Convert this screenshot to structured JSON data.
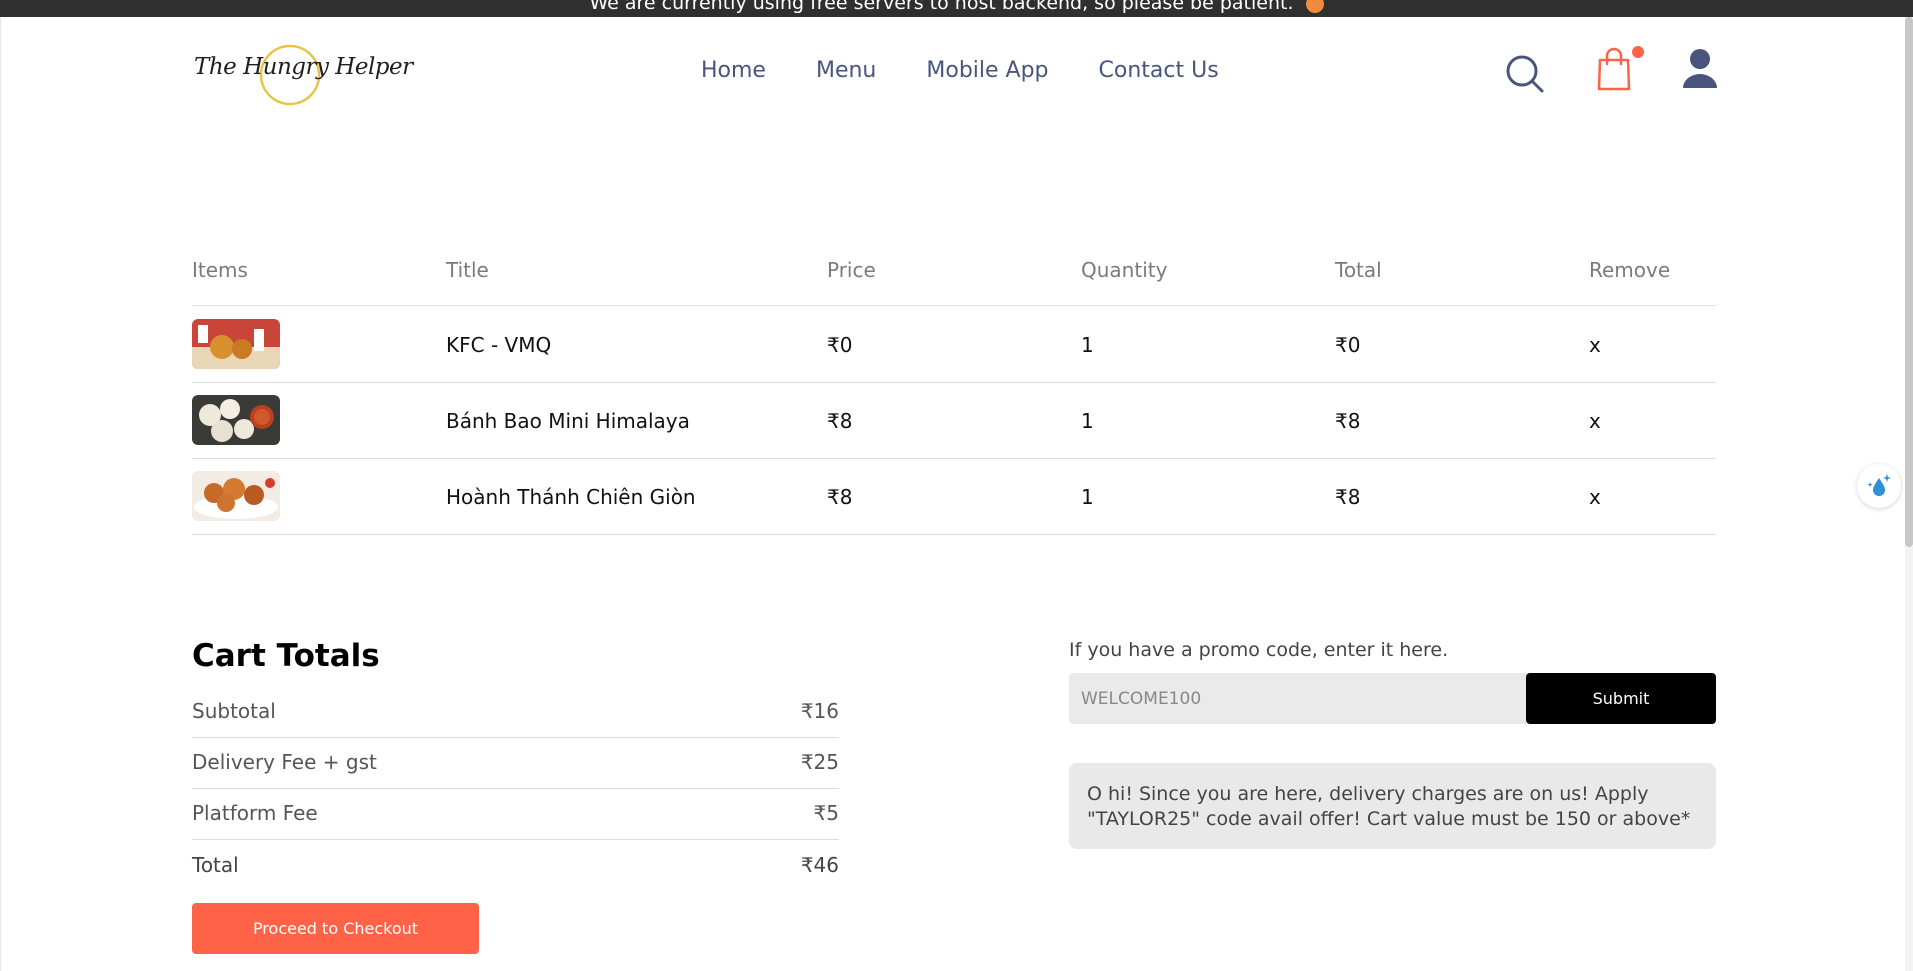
{
  "banner": {
    "text": "We are currently using free servers to host backend, so please be patient."
  },
  "brand": {
    "logo_text": "The Hungry Helper"
  },
  "nav": {
    "items": [
      "Home",
      "Menu",
      "Mobile App",
      "Contact Us"
    ]
  },
  "header_icons": {
    "search": "search-icon",
    "cart": "shopping-bag-icon",
    "profile": "user-icon",
    "cart_badge_color": "#ff6347"
  },
  "cart": {
    "headers": {
      "items": "Items",
      "title": "Title",
      "price": "Price",
      "quantity": "Quantity",
      "total": "Total",
      "remove": "Remove"
    },
    "rows": [
      {
        "title": "KFC - VMQ",
        "price": "₹0",
        "quantity": "1",
        "total": "₹0",
        "remove": "x"
      },
      {
        "title": "Bánh Bao Mini Himalaya",
        "price": "₹8",
        "quantity": "1",
        "total": "₹8",
        "remove": "x"
      },
      {
        "title": "Hoành Thánh Chiên Giòn",
        "price": "₹8",
        "quantity": "1",
        "total": "₹8",
        "remove": "x"
      }
    ]
  },
  "totals": {
    "heading": "Cart Totals",
    "subtotal_label": "Subtotal",
    "subtotal_value": "₹16",
    "delivery_label": "Delivery Fee + gst",
    "delivery_value": "₹25",
    "platform_label": "Platform Fee",
    "platform_value": "₹5",
    "total_label": "Total",
    "total_value": "₹46",
    "checkout_label": "Proceed to Checkout"
  },
  "promo": {
    "label": "If you have a promo code, enter it here.",
    "input_value": "WELCOME100",
    "submit_label": "Submit",
    "note": "O hi! Since you are here, delivery charges are on us! Apply \"TAYLOR25\" code avail offer! Cart value must be 150 or above*"
  },
  "colors": {
    "accent": "#ff6347",
    "nav_text": "#49557e",
    "dark": "#000000"
  }
}
